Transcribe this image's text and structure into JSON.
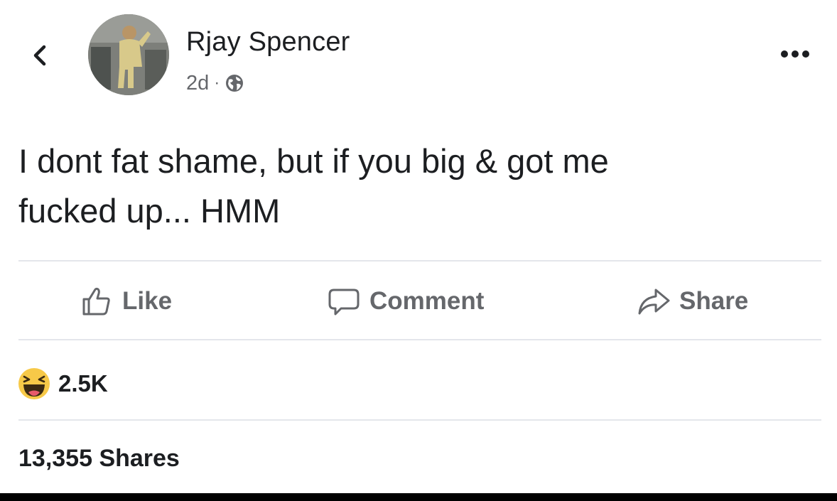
{
  "post": {
    "author": "Rjay Spencer",
    "time": "2d",
    "separator": "·",
    "privacy_icon": "globe-icon",
    "text_line_1": "I dont fat shame, but if you big & got me",
    "text_line_2": "fucked up... HMM"
  },
  "nav": {
    "back_icon": "chevron-left-icon",
    "more_icon": "more-horizontal-icon"
  },
  "actions": {
    "like_label": "Like",
    "comment_label": "Comment",
    "share_label": "Share"
  },
  "stats": {
    "reaction_icon": "haha-reaction-icon",
    "reaction_count": "2.5K",
    "shares": "13,355 Shares"
  },
  "colors": {
    "text_primary": "#1c1e21",
    "text_secondary": "#65676b",
    "divider": "#e4e6eb",
    "haha_yellow": "#f7c948"
  }
}
